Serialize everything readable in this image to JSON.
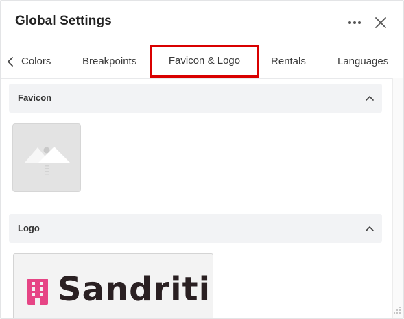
{
  "header": {
    "title": "Global Settings",
    "more_icon": "ellipsis-horizontal-icon",
    "close_icon": "close-icon"
  },
  "tabs": [
    {
      "label": "Colors",
      "icon": "chevron-left-icon"
    },
    {
      "label": "Breakpoints"
    },
    {
      "label": "Favicon & Logo",
      "active": true,
      "highlight_color": "#d90000"
    },
    {
      "label": "Rentals"
    },
    {
      "label": "Languages"
    }
  ],
  "sections": {
    "favicon": {
      "title": "Favicon",
      "expanded": true,
      "image": "image-placeholder-icon"
    },
    "logo": {
      "title": "Logo",
      "expanded": true,
      "brand_text": "Sandriti",
      "brand_icon": "building-icon",
      "brand_color": "#e64585"
    }
  },
  "colors": {
    "accent_highlight": "#d90000",
    "section_bg": "#f2f3f5",
    "logo_pink": "#e64585"
  }
}
